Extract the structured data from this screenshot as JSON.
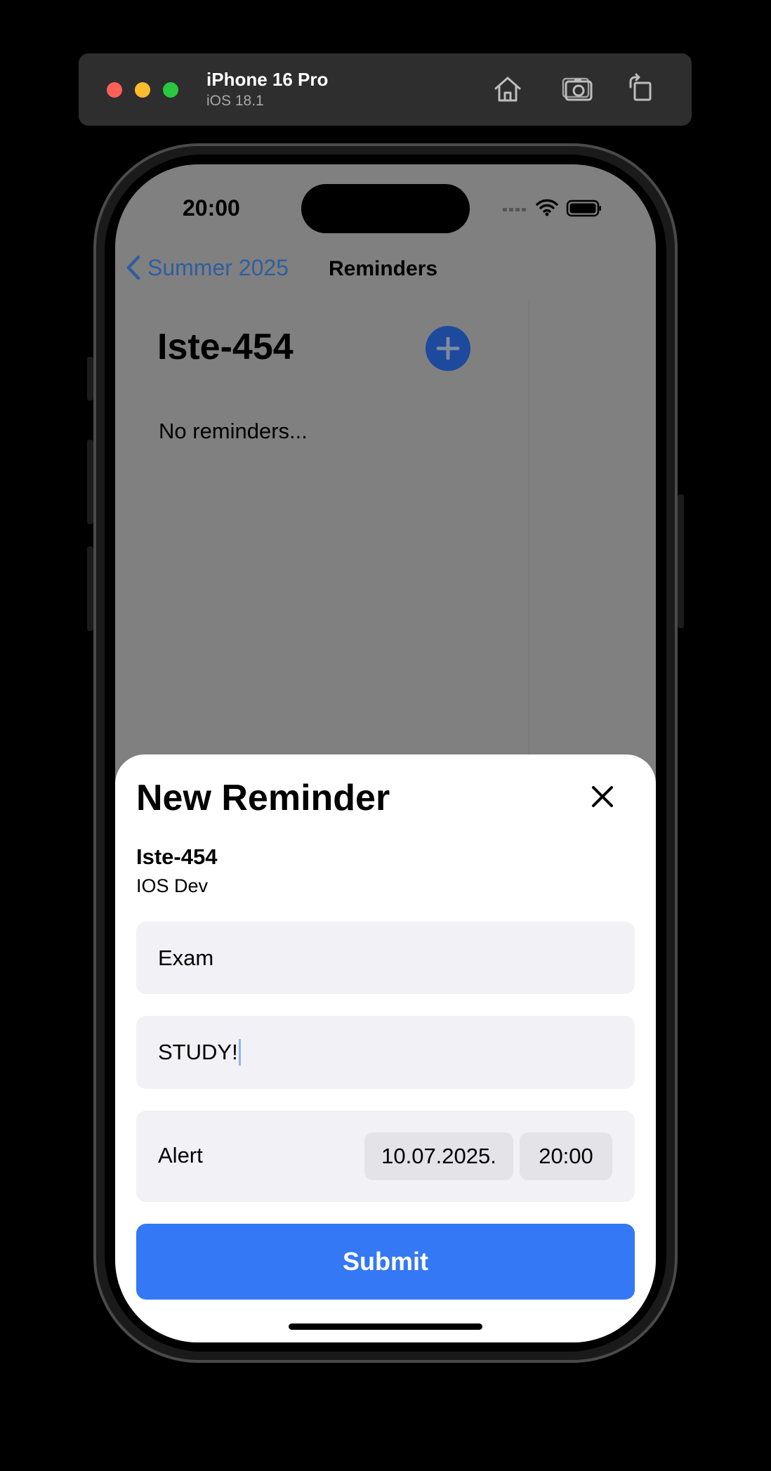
{
  "simulator": {
    "device_name": "iPhone 16 Pro",
    "os_version": "iOS 18.1",
    "buttons": [
      "home-icon",
      "screenshot-icon",
      "rotate-icon"
    ]
  },
  "status_bar": {
    "time": "20:00"
  },
  "nav": {
    "back_label": "Summer 2025",
    "title": "Reminders"
  },
  "list": {
    "title": "Iste-454",
    "empty_text": "No reminders..."
  },
  "sheet": {
    "title": "New Reminder",
    "course_code": "Iste-454",
    "course_name": "IOS Dev",
    "title_field_value": "Exam",
    "notes_field_value": "STUDY!",
    "alert_label": "Alert",
    "alert_date": "10.07.2025.",
    "alert_time": "20:00",
    "submit_label": "Submit"
  },
  "colors": {
    "accent": "#3478f6",
    "dimmed_accent": "#1d4a9c",
    "field_bg": "#f1f1f6"
  }
}
